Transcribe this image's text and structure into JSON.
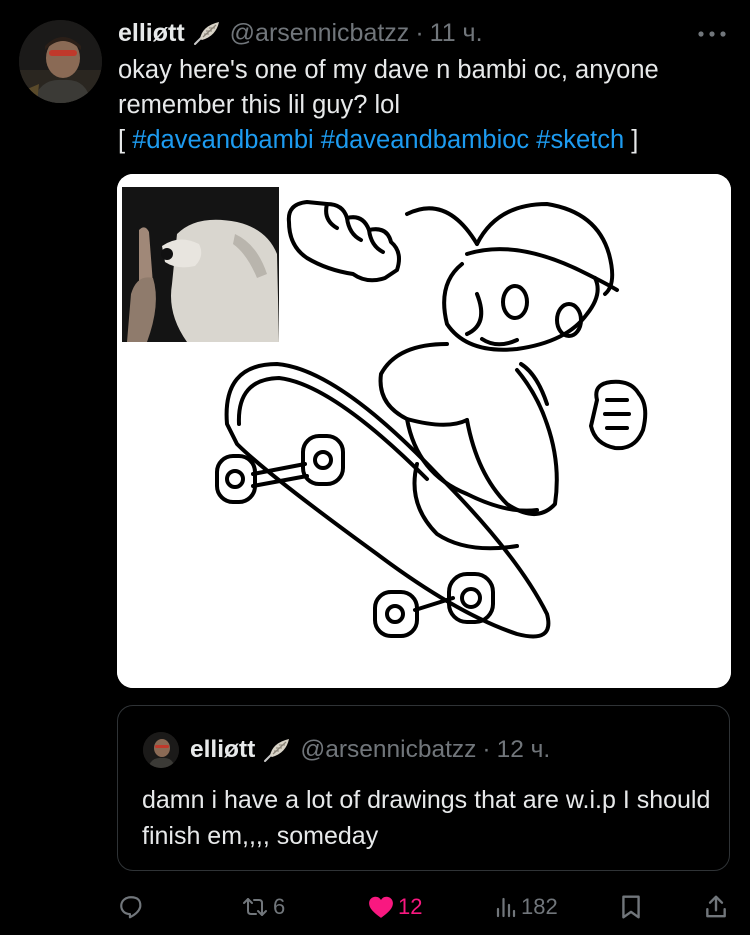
{
  "post": {
    "author_name": "elliøtt",
    "author_handle": "@arsennicbatzz",
    "separator": "·",
    "time": "11 ч.",
    "text_line1": "okay here's one of my dave n bambi oc, anyone",
    "text_line2": "remember this lil guy? lol",
    "bracket_open": "[",
    "bracket_close": "]",
    "hashtags": [
      "#daveandbambi",
      "#daveandbambioc",
      "#sketch"
    ]
  },
  "quote": {
    "author_name": "elliøtt",
    "author_handle": "@arsennicbatzz",
    "separator": "·",
    "time": "12 ч.",
    "text": "damn i have a lot of drawings that are w.i.p I should finish em,,,, someday"
  },
  "actions": {
    "replies": "",
    "reposts": "6",
    "likes": "12",
    "views": "182"
  },
  "colors": {
    "background": "#000000",
    "text": "#e7e9ea",
    "muted": "#71767b",
    "link": "#1d9bf0",
    "like": "#f91880",
    "border": "#2f3336"
  },
  "icons": [
    "more-icon",
    "feather-icon",
    "reply-icon",
    "repost-icon",
    "like-icon",
    "views-icon",
    "bookmark-icon",
    "share-icon"
  ]
}
